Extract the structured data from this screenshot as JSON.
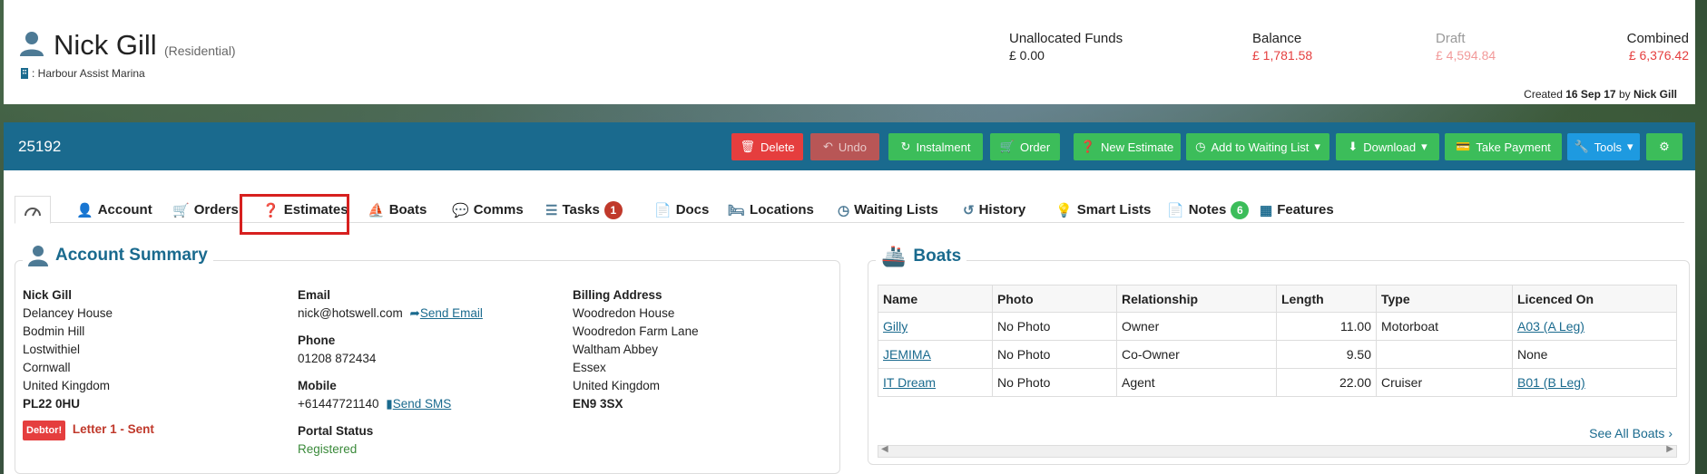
{
  "header": {
    "name": "Nick Gill",
    "type": "(Residential)",
    "site": ": Harbour Assist Marina",
    "unallocated_label": "Unallocated Funds",
    "unallocated_value": "£ 0.00",
    "balance_label": "Balance",
    "balance_value": "£ 1,781.58",
    "draft_label": "Draft",
    "draft_value": "£ 4,594.84",
    "combined_label": "Combined",
    "combined_value": "£ 6,376.42",
    "created_prefix": "Created",
    "created_date": "16 Sep 17",
    "created_by_prefix": "by",
    "created_by": "Nick Gill"
  },
  "toolbar": {
    "account_number": "25192",
    "delete": "Delete",
    "undo": "Undo",
    "instalment": "Instalment",
    "order": "Order",
    "new_estimate": "New Estimate",
    "waiting_list": "Add to Waiting List",
    "download": "Download",
    "take_payment": "Take Payment",
    "tools": "Tools"
  },
  "tabs": {
    "account": "Account",
    "orders": "Orders",
    "estimates": "Estimates",
    "boats": "Boats",
    "comms": "Comms",
    "tasks": "Tasks",
    "tasks_count": "1",
    "docs": "Docs",
    "locations": "Locations",
    "waiting_lists": "Waiting Lists",
    "history": "History",
    "smart_lists": "Smart Lists",
    "notes": "Notes",
    "notes_count": "6",
    "features": "Features"
  },
  "account_summary": {
    "title": "Account Summary",
    "address": [
      "Nick Gill",
      "Delancey House",
      "Bodmin Hill",
      "Lostwithiel",
      "Cornwall",
      "United Kingdom",
      "PL22 0HU"
    ],
    "debtor_badge": "Debtor!",
    "letter_status": "Letter 1 - Sent",
    "email_label": "Email",
    "email": "nick@hotswell.com",
    "send_email": "Send Email",
    "phone_label": "Phone",
    "phone": "01208 872434",
    "mobile_label": "Mobile",
    "mobile": "+61447721140",
    "send_sms": "Send SMS",
    "portal_label": "Portal Status",
    "portal_status": "Registered",
    "billing_label": "Billing Address",
    "billing": [
      "Woodredon House",
      "Woodredon Farm Lane",
      "Waltham Abbey",
      "Essex",
      "United Kingdom",
      "EN9 3SX"
    ]
  },
  "boats": {
    "title": "Boats",
    "columns": [
      "Name",
      "Photo",
      "Relationship",
      "Length",
      "Type",
      "Licenced On"
    ],
    "rows": [
      [
        "Gilly",
        "No Photo",
        "Owner",
        "11.00",
        "Motorboat",
        "A03 (A Leg)"
      ],
      [
        "JEMIMA",
        "No Photo",
        "Co-Owner",
        "9.50",
        "",
        "None"
      ],
      [
        "IT Dream",
        "No Photo",
        "Agent",
        "22.00",
        "Cruiser",
        "B01 (B Leg)"
      ]
    ],
    "see_all": "See All Boats"
  },
  "colors": {
    "brand_blue": "#1a6a8e",
    "danger": "#e53e3e",
    "success": "#3cbd5a",
    "info": "#1e9ae0"
  }
}
